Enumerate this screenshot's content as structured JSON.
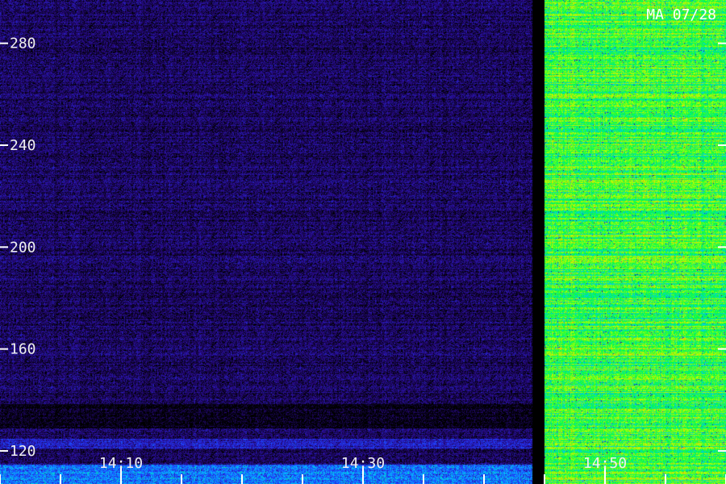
{
  "chart_data": {
    "type": "heatmap",
    "title": "",
    "xlabel": "",
    "ylabel": "",
    "stamp": "MA 07/28",
    "y_ticks": [
      120,
      160,
      200,
      240,
      280
    ],
    "y_tick_labels": [
      "120",
      "160",
      "200",
      "240",
      "280"
    ],
    "ylim": [
      107,
      297
    ],
    "x_ticks": [
      "14:10",
      "14:30",
      "14:50"
    ],
    "x_tick_labels": [
      "14:10",
      "14:30",
      "14:50"
    ],
    "xlim": [
      "14:00",
      "14:60"
    ],
    "x_minor_tick_interval_minutes": 5,
    "colormap": [
      "#000000",
      "#2a0a8c",
      "#1f3cff",
      "#00c8ff",
      "#00ff40",
      "#c8ff00",
      "#ff8000",
      "#ff0000"
    ],
    "regions": [
      {
        "from": "14:00",
        "to": "14:44",
        "intensity": "low"
      },
      {
        "from": "14:44",
        "to": "14:45",
        "intensity": "none"
      },
      {
        "from": "14:45",
        "to": "14:60",
        "intensity": "high"
      }
    ]
  }
}
